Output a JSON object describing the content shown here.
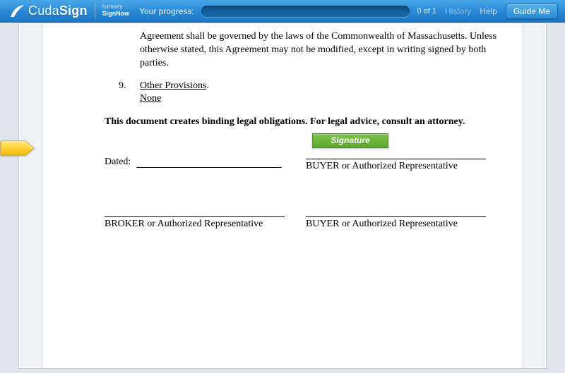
{
  "header": {
    "brand_prefix": "Cuda",
    "brand_suffix": "Sign",
    "formerly_label": "formerly",
    "formerly_name": "SignNow",
    "progress_label": "Your progress:",
    "progress_count": "0 of 1",
    "history_link": "History",
    "help_link": "Help",
    "guide_button": "Guide Me"
  },
  "doc": {
    "para_tail": "Agreement shall be governed by the laws of the Commonwealth of Massachusetts.  Unless otherwise stated, this Agreement may not be modified, except in writing signed by both parties.",
    "item_number": "9.",
    "item_title": "Other Provisions",
    "item_body": "None",
    "notice": "This document creates binding legal obligations.  For legal advice, consult an attorney.",
    "dated_label": "Dated:",
    "buyer_label": "BUYER or Authorized Representative",
    "broker_label": "BROKER or Authorized Representative",
    "signature_button": "Signature"
  }
}
